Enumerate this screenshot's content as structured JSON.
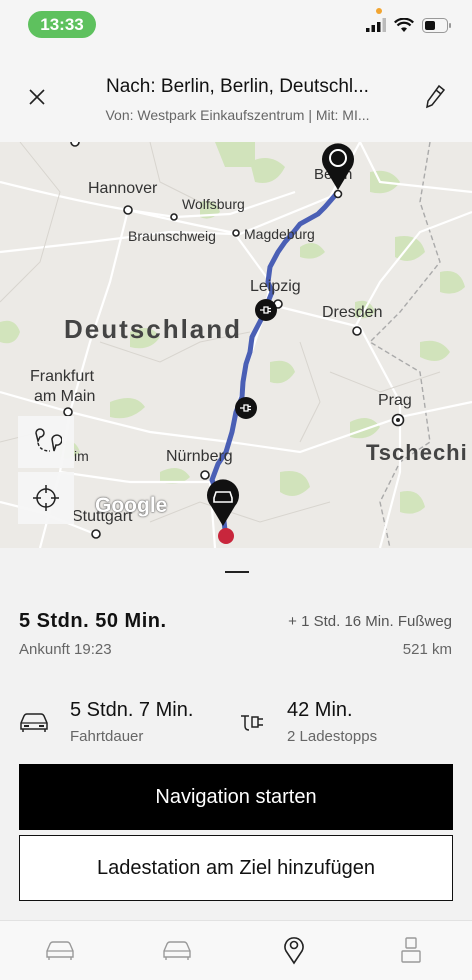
{
  "status_bar": {
    "time": "13:33"
  },
  "header": {
    "title": "Nach: Berlin, Berlin, Deutschl...",
    "subtitle": "Von: Westpark Einkaufszentrum | Mit: MI..."
  },
  "map": {
    "country_labels": [
      "Deutschland",
      "Tschechi"
    ],
    "cities": [
      "Hannover",
      "Wolfsburg",
      "Braunschweig",
      "Magdeburg",
      "Berlin",
      "Leipzig",
      "Dresden",
      "Frankfurt",
      "am Main",
      "Prag",
      "Nürnberg",
      "Stuttgart",
      "im"
    ],
    "attribution": "Google",
    "route_color": "#4a5fb5",
    "destination_color": "#c8263c"
  },
  "summary": {
    "total_time": "5 Stdn. 50 Min.",
    "walk": "+ 1 Std. 16 Min. Fußweg",
    "arrival": "Ankunft 19:23",
    "distance": "521 km"
  },
  "stats": {
    "drive_value": "5 Stdn. 7 Min.",
    "drive_label": "Fahrtdauer",
    "charge_value": "42 Min.",
    "charge_label": "2 Ladestopps"
  },
  "actions": {
    "start_navigation": "Navigation starten",
    "add_charging_station": "Ladestation am Ziel hinzufügen"
  },
  "tabbar": {
    "icons": [
      "car-icon",
      "car-icon",
      "map-pin-icon",
      "profile-icon"
    ]
  }
}
